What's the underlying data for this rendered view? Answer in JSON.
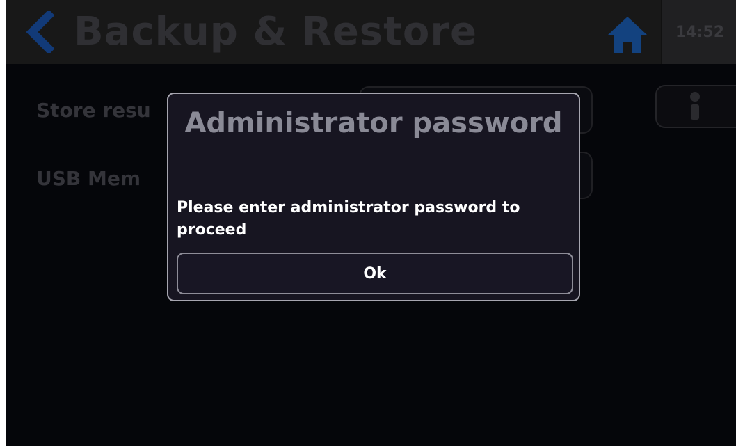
{
  "header": {
    "title": "Backup & Restore",
    "time": "14:52",
    "back_icon": "chevron-left-icon",
    "home_icon": "home-icon",
    "accent_color": "#1f6fe0"
  },
  "background": {
    "rows": [
      {
        "label": "Store resu"
      },
      {
        "label": "USB Mem"
      }
    ],
    "info_icon": "info-icon"
  },
  "modal": {
    "title": "Administrator password",
    "message": "Please enter administrator password to proceed",
    "ok_label": "Ok"
  }
}
